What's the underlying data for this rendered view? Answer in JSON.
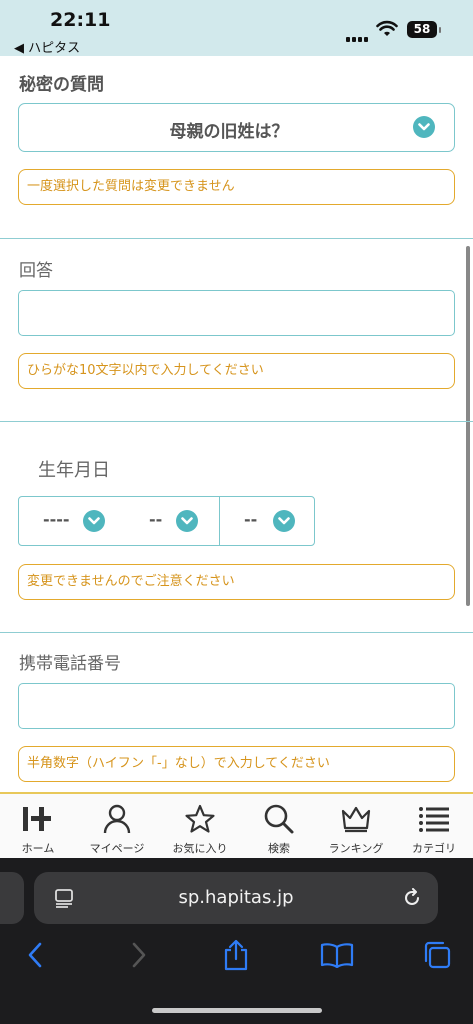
{
  "status_bar": {
    "time": "22:11",
    "back_app": "◀ ハピタス",
    "battery": "58"
  },
  "secret_question": {
    "label": "秘密の質問",
    "selected": "母親の旧姓は？",
    "note": "一度選択した質問は変更できません"
  },
  "answer": {
    "label": "回答",
    "value": "",
    "note": "ひらがな10文字以内で入力してください"
  },
  "birthday": {
    "label": "生年月日",
    "year": "----",
    "month": "--",
    "day": "--",
    "note": "変更できませんのでご注意ください"
  },
  "phone": {
    "label": "携帯電話番号",
    "value": "",
    "note": "半角数字（ハイフン「-」なし）で入力してください"
  },
  "tabbar": {
    "items": [
      {
        "label": "ホーム",
        "icon": "home-logo-icon"
      },
      {
        "label": "マイページ",
        "icon": "person-icon"
      },
      {
        "label": "お気に入り",
        "icon": "star-icon"
      },
      {
        "label": "検索",
        "icon": "search-icon"
      },
      {
        "label": "ランキング",
        "icon": "crown-icon"
      },
      {
        "label": "カテゴリ",
        "icon": "list-icon"
      }
    ]
  },
  "browser": {
    "url": "sp.hapitas.jp"
  },
  "colors": {
    "teal": "#4fb6be",
    "orange": "#e3a92d",
    "status_bg": "#d2e9ec"
  }
}
